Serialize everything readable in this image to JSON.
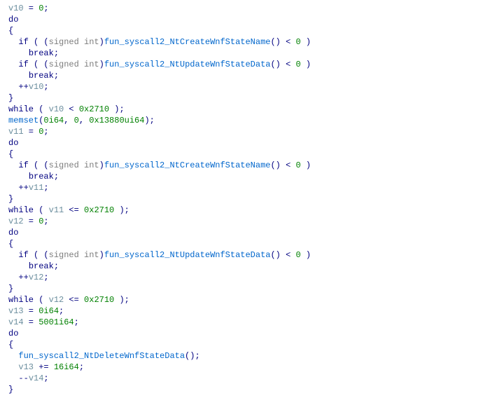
{
  "code": {
    "lines": [
      {
        "indent": 0,
        "tokens": [
          {
            "t": "variable",
            "v": "v10"
          },
          {
            "t": "text",
            "v": " = "
          },
          {
            "t": "number",
            "v": "0"
          },
          {
            "t": "text",
            "v": ";"
          }
        ]
      },
      {
        "indent": 0,
        "tokens": [
          {
            "t": "keyword",
            "v": "do"
          }
        ]
      },
      {
        "indent": 0,
        "tokens": [
          {
            "t": "text",
            "v": "{"
          }
        ]
      },
      {
        "indent": 1,
        "tokens": [
          {
            "t": "keyword",
            "v": "if"
          },
          {
            "t": "text",
            "v": " ( ("
          },
          {
            "t": "cast",
            "v": "signed int"
          },
          {
            "t": "text",
            "v": ")"
          },
          {
            "t": "function",
            "v": "fun_syscall2_NtCreateWnfStateName"
          },
          {
            "t": "text",
            "v": "() < "
          },
          {
            "t": "number",
            "v": "0"
          },
          {
            "t": "text",
            "v": " )"
          }
        ]
      },
      {
        "indent": 2,
        "tokens": [
          {
            "t": "keyword",
            "v": "break"
          },
          {
            "t": "text",
            "v": ";"
          }
        ]
      },
      {
        "indent": 1,
        "tokens": [
          {
            "t": "keyword",
            "v": "if"
          },
          {
            "t": "text",
            "v": " ( ("
          },
          {
            "t": "cast",
            "v": "signed int"
          },
          {
            "t": "text",
            "v": ")"
          },
          {
            "t": "function",
            "v": "fun_syscall2_NtUpdateWnfStateData"
          },
          {
            "t": "text",
            "v": "() < "
          },
          {
            "t": "number",
            "v": "0"
          },
          {
            "t": "text",
            "v": " )"
          }
        ]
      },
      {
        "indent": 2,
        "tokens": [
          {
            "t": "keyword",
            "v": "break"
          },
          {
            "t": "text",
            "v": ";"
          }
        ]
      },
      {
        "indent": 1,
        "tokens": [
          {
            "t": "text",
            "v": "++"
          },
          {
            "t": "variable",
            "v": "v10"
          },
          {
            "t": "text",
            "v": ";"
          }
        ]
      },
      {
        "indent": 0,
        "tokens": [
          {
            "t": "text",
            "v": "}"
          }
        ]
      },
      {
        "indent": 0,
        "tokens": [
          {
            "t": "keyword",
            "v": "while"
          },
          {
            "t": "text",
            "v": " ( "
          },
          {
            "t": "variable",
            "v": "v10"
          },
          {
            "t": "text",
            "v": " < "
          },
          {
            "t": "number",
            "v": "0x2710"
          },
          {
            "t": "text",
            "v": " );"
          }
        ]
      },
      {
        "indent": 0,
        "tokens": [
          {
            "t": "function",
            "v": "memset"
          },
          {
            "t": "text",
            "v": "("
          },
          {
            "t": "number",
            "v": "0i64"
          },
          {
            "t": "text",
            "v": ", "
          },
          {
            "t": "number",
            "v": "0"
          },
          {
            "t": "text",
            "v": ", "
          },
          {
            "t": "number",
            "v": "0x13880ui64"
          },
          {
            "t": "text",
            "v": ");"
          }
        ]
      },
      {
        "indent": 0,
        "tokens": [
          {
            "t": "variable",
            "v": "v11"
          },
          {
            "t": "text",
            "v": " = "
          },
          {
            "t": "number",
            "v": "0"
          },
          {
            "t": "text",
            "v": ";"
          }
        ]
      },
      {
        "indent": 0,
        "tokens": [
          {
            "t": "keyword",
            "v": "do"
          }
        ]
      },
      {
        "indent": 0,
        "tokens": [
          {
            "t": "text",
            "v": "{"
          }
        ]
      },
      {
        "indent": 1,
        "tokens": [
          {
            "t": "keyword",
            "v": "if"
          },
          {
            "t": "text",
            "v": " ( ("
          },
          {
            "t": "cast",
            "v": "signed int"
          },
          {
            "t": "text",
            "v": ")"
          },
          {
            "t": "function",
            "v": "fun_syscall2_NtCreateWnfStateName"
          },
          {
            "t": "text",
            "v": "() < "
          },
          {
            "t": "number",
            "v": "0"
          },
          {
            "t": "text",
            "v": " )"
          }
        ]
      },
      {
        "indent": 2,
        "tokens": [
          {
            "t": "keyword",
            "v": "break"
          },
          {
            "t": "text",
            "v": ";"
          }
        ]
      },
      {
        "indent": 1,
        "tokens": [
          {
            "t": "text",
            "v": "++"
          },
          {
            "t": "variable",
            "v": "v11"
          },
          {
            "t": "text",
            "v": ";"
          }
        ]
      },
      {
        "indent": 0,
        "tokens": [
          {
            "t": "text",
            "v": "}"
          }
        ]
      },
      {
        "indent": 0,
        "tokens": [
          {
            "t": "keyword",
            "v": "while"
          },
          {
            "t": "text",
            "v": " ( "
          },
          {
            "t": "variable",
            "v": "v11"
          },
          {
            "t": "text",
            "v": " <= "
          },
          {
            "t": "number",
            "v": "0x2710"
          },
          {
            "t": "text",
            "v": " );"
          }
        ]
      },
      {
        "indent": 0,
        "tokens": [
          {
            "t": "variable",
            "v": "v12"
          },
          {
            "t": "text",
            "v": " = "
          },
          {
            "t": "number",
            "v": "0"
          },
          {
            "t": "text",
            "v": ";"
          }
        ]
      },
      {
        "indent": 0,
        "tokens": [
          {
            "t": "keyword",
            "v": "do"
          }
        ]
      },
      {
        "indent": 0,
        "tokens": [
          {
            "t": "text",
            "v": "{"
          }
        ]
      },
      {
        "indent": 1,
        "tokens": [
          {
            "t": "keyword",
            "v": "if"
          },
          {
            "t": "text",
            "v": " ( ("
          },
          {
            "t": "cast",
            "v": "signed int"
          },
          {
            "t": "text",
            "v": ")"
          },
          {
            "t": "function",
            "v": "fun_syscall2_NtUpdateWnfStateData"
          },
          {
            "t": "text",
            "v": "() < "
          },
          {
            "t": "number",
            "v": "0"
          },
          {
            "t": "text",
            "v": " )"
          }
        ]
      },
      {
        "indent": 2,
        "tokens": [
          {
            "t": "keyword",
            "v": "break"
          },
          {
            "t": "text",
            "v": ";"
          }
        ]
      },
      {
        "indent": 1,
        "tokens": [
          {
            "t": "text",
            "v": "++"
          },
          {
            "t": "variable",
            "v": "v12"
          },
          {
            "t": "text",
            "v": ";"
          }
        ]
      },
      {
        "indent": 0,
        "tokens": [
          {
            "t": "text",
            "v": "}"
          }
        ]
      },
      {
        "indent": 0,
        "tokens": [
          {
            "t": "keyword",
            "v": "while"
          },
          {
            "t": "text",
            "v": " ( "
          },
          {
            "t": "variable",
            "v": "v12"
          },
          {
            "t": "text",
            "v": " <= "
          },
          {
            "t": "number",
            "v": "0x2710"
          },
          {
            "t": "text",
            "v": " );"
          }
        ]
      },
      {
        "indent": 0,
        "tokens": [
          {
            "t": "variable",
            "v": "v13"
          },
          {
            "t": "text",
            "v": " = "
          },
          {
            "t": "number",
            "v": "0i64"
          },
          {
            "t": "text",
            "v": ";"
          }
        ]
      },
      {
        "indent": 0,
        "tokens": [
          {
            "t": "variable",
            "v": "v14"
          },
          {
            "t": "text",
            "v": " = "
          },
          {
            "t": "number",
            "v": "5001i64"
          },
          {
            "t": "text",
            "v": ";"
          }
        ]
      },
      {
        "indent": 0,
        "tokens": [
          {
            "t": "keyword",
            "v": "do"
          }
        ]
      },
      {
        "indent": 0,
        "tokens": [
          {
            "t": "text",
            "v": "{"
          }
        ]
      },
      {
        "indent": 1,
        "tokens": [
          {
            "t": "function",
            "v": "fun_syscall2_NtDeleteWnfStateData"
          },
          {
            "t": "text",
            "v": "();"
          }
        ]
      },
      {
        "indent": 1,
        "tokens": [
          {
            "t": "variable",
            "v": "v13"
          },
          {
            "t": "text",
            "v": " += "
          },
          {
            "t": "number",
            "v": "16i64"
          },
          {
            "t": "text",
            "v": ";"
          }
        ]
      },
      {
        "indent": 1,
        "tokens": [
          {
            "t": "text",
            "v": "--"
          },
          {
            "t": "variable",
            "v": "v14"
          },
          {
            "t": "text",
            "v": ";"
          }
        ]
      },
      {
        "indent": 0,
        "tokens": [
          {
            "t": "text",
            "v": "}"
          }
        ]
      }
    ]
  }
}
